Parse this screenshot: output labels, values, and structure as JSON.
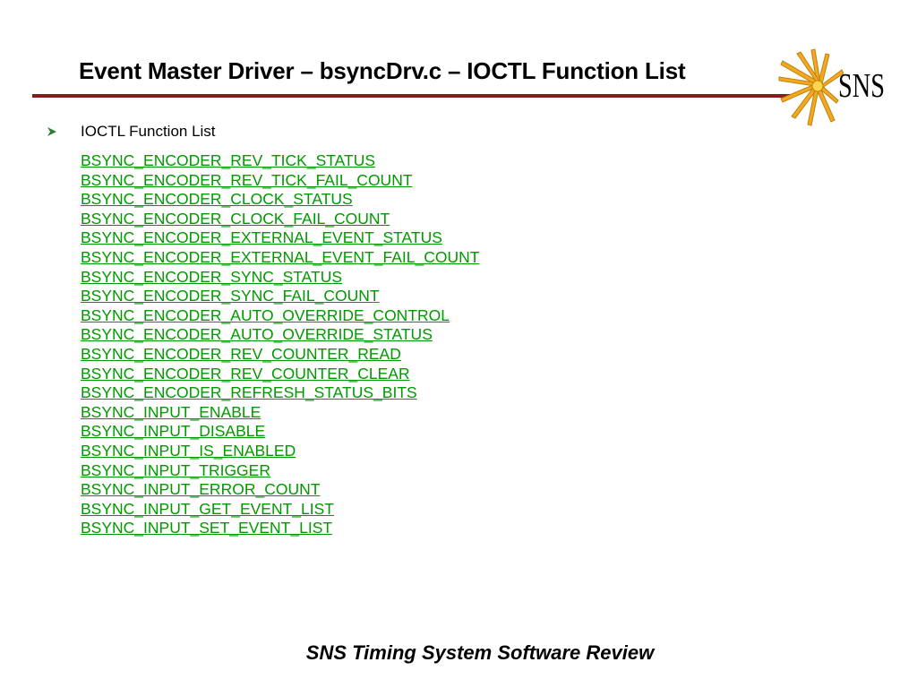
{
  "slide": {
    "title": "Event Master Driver – bsyncDrv.c – IOCTL Function List",
    "logo_text": "SNS",
    "bullet": "IOCTL Function List",
    "functions": [
      "BSYNC_ENCODER_REV_TICK_STATUS",
      "BSYNC_ENCODER_REV_TICK_FAIL_COUNT",
      "BSYNC_ENCODER_CLOCK_STATUS",
      "BSYNC_ENCODER_CLOCK_FAIL_COUNT",
      "BSYNC_ENCODER_EXTERNAL_EVENT_STATUS",
      "BSYNC_ENCODER_EXTERNAL_EVENT_FAIL_COUNT",
      "BSYNC_ENCODER_SYNC_STATUS",
      "BSYNC_ENCODER_SYNC_FAIL_COUNT",
      "BSYNC_ENCODER_AUTO_OVERRIDE_CONTROL",
      "BSYNC_ENCODER_AUTO_OVERRIDE_STATUS",
      "BSYNC_ENCODER_REV_COUNTER_READ",
      "BSYNC_ENCODER_REV_COUNTER_CLEAR",
      "BSYNC_ENCODER_REFRESH_STATUS_BITS",
      "BSYNC_INPUT_ENABLE",
      "BSYNC_INPUT_DISABLE",
      "BSYNC_INPUT_IS_ENABLED",
      "BSYNC_INPUT_TRIGGER",
      "BSYNC_INPUT_ERROR_COUNT",
      "BSYNC_INPUT_GET_EVENT_LIST",
      "BSYNC_INPUT_SET_EVENT_LIST"
    ],
    "footer": "SNS Timing System Software Review"
  },
  "colors": {
    "title_rule": "#8b1a1a",
    "link": "#009900",
    "bullet_arrow": "#2e7d32",
    "logo_burst": "#f5a623",
    "logo_burst_stroke": "#b8860b"
  }
}
